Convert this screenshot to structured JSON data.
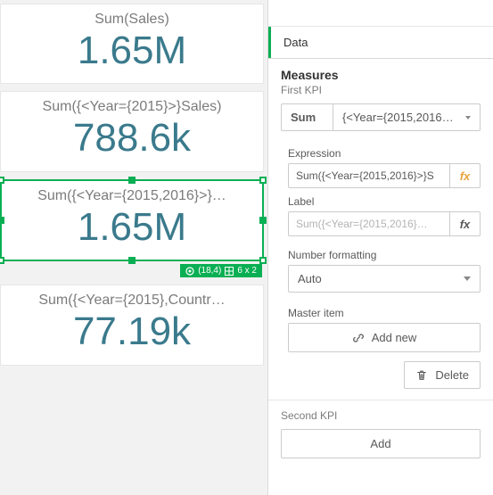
{
  "cards": [
    {
      "label": "Sum(Sales)",
      "value": "1.65M",
      "selected": false
    },
    {
      "label": "Sum({<Year={2015}>}Sales)",
      "value": "788.6k",
      "selected": false
    },
    {
      "label": "Sum({<Year={2015,2016}>}…",
      "value": "1.65M",
      "selected": true
    },
    {
      "label": "Sum({<Year={2015},Countr…",
      "value": "77.19k",
      "selected": false
    }
  ],
  "selection_badge": {
    "pos": "(18,4)",
    "size": "6 x 2"
  },
  "panel": {
    "tab": "Data",
    "measures": {
      "title": "Measures",
      "first_label": "First KPI",
      "agg": "Sum",
      "field": "{<Year={2015,2016…",
      "expression_label": "Expression",
      "expression_value": "Sum({<Year={2015,2016}>}S",
      "label_label": "Label",
      "label_placeholder": "Sum({<Year={2015,2016}…",
      "number_formatting_label": "Number formatting",
      "number_formatting_value": "Auto",
      "master_item_label": "Master item",
      "add_new": "Add new",
      "delete": "Delete",
      "second_label": "Second KPI",
      "add": "Add"
    }
  }
}
